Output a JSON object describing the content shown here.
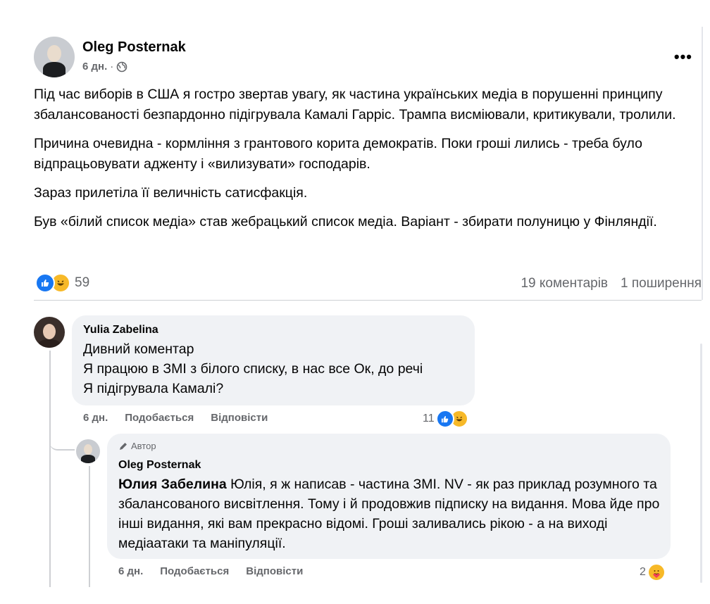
{
  "post": {
    "author": "Oleg Posternak",
    "time": "6 дн.",
    "separator": "·",
    "more_label": "•••",
    "paragraphs": [
      "Під час виборів в США я гостро звертав увагу, як частина українських медіа в порушенні принципу збалансованості безпардонно підігрувала Камалі Гарріс. Трампа висміювали, критикували, тролили.",
      "Причина очевидна - кормління з грантового корита демократів. Поки гроші лились - треба було відпрацьовувати адженту і «вилизувати» господарів.",
      "Зараз прилетіла її величність сатисфакція.",
      "Був «білий список медіа» став жебрацький список медіа. Варіант - збирати полуницю у Фінляндії."
    ],
    "reaction_count": "59",
    "comments_count": "19 коментарів",
    "shares_count": "1 поширення",
    "reaction_icons": [
      "like-icon",
      "haha-icon"
    ]
  },
  "comments": [
    {
      "author": "Yulia Zabelina",
      "lines": [
        "Дивний коментар",
        "Я працюю в ЗМІ з білого списку, в нас все Ок, до речі",
        "Я підігрувала Камалі?"
      ],
      "time": "6 дн.",
      "like_label": "Подобається",
      "reply_label": "Відповісти",
      "reaction_count": "11",
      "reaction_icons": [
        "like-icon",
        "haha-icon"
      ]
    }
  ],
  "reply": {
    "badge": "Автор",
    "author": "Oleg Posternak",
    "mention": "Юлия Забелина",
    "text": " Юлія, я ж написав - частина ЗМІ. NV - як раз приклад розумного та збалансованого висвітлення. Тому і й продовжив підписку на видання. Мова йде про інші видання, які вам прекрасно відомі. Гроші заливались рікою - а на виході медіаатаки та маніпуляції.",
    "time": "6 дн.",
    "like_label": "Подобається",
    "reply_label": "Відповісти",
    "reaction_count": "2",
    "reaction_icons": [
      "care-icon"
    ]
  },
  "colors": {
    "like": "#1877f2",
    "haha": "#f7b928",
    "secondary_text": "#65676b",
    "bubble": "#f0f2f5"
  }
}
